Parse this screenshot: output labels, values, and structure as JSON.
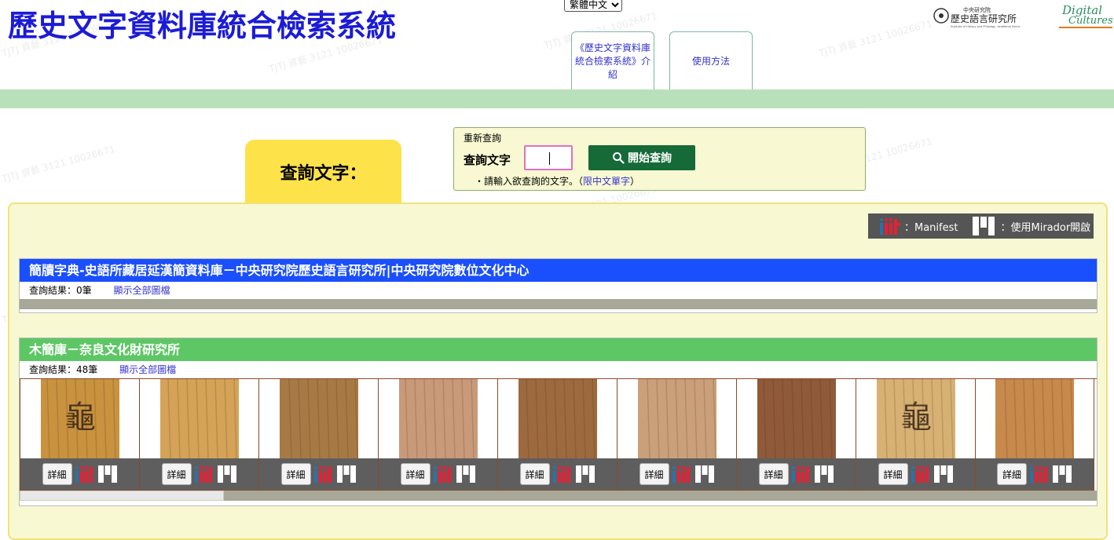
{
  "header": {
    "title": "歷史文字資料庫統合檢索系統",
    "language_selected": "繁體中文",
    "tabs": [
      {
        "label": "《歷史文字資料庫統合檢索系統》介紹"
      },
      {
        "label": "使用方法"
      }
    ],
    "logo_ihp": {
      "main": "歷史語言研究所",
      "top": "中央研究院",
      "sub": "Institute of History and Philology, Academia Sinica"
    },
    "logo_dc": {
      "line1": "Digital",
      "line2": "Cultures",
      "colors": [
        "#2a8f5c",
        "#e07a1e"
      ]
    }
  },
  "query": {
    "tab_label": "查詢文字：",
    "legend": "重新查詢",
    "label": "查詢文字",
    "input_value": "",
    "search_button": "開始查詢",
    "hint": "・請輸入欲查詢的文字。（",
    "hint_link": "限中文單字",
    "hint_end": "）"
  },
  "iiif_legend": {
    "manifest_label": "：Manifest",
    "mirador_label": "：使用Mirador開啟"
  },
  "databases": [
    {
      "title": "簡牘字典-史語所藏居延漢簡資料庫－中央研究院歷史語言研究所|中央研究院數位文化中心",
      "result_label": "查詢結果：0筆",
      "show_all": "顯示全部圖檔",
      "header_color": "#1a4ffd"
    },
    {
      "title": "木簡庫－奈良文化財研究所",
      "result_label": "查詢結果：48筆",
      "show_all": "顯示全部圖檔",
      "header_color": "#5ec765",
      "scroll_position": 0.19
    }
  ],
  "results": [
    {
      "detail": "詳細",
      "glyph": "龜",
      "tone": "#c8923f"
    },
    {
      "detail": "詳細",
      "glyph": "",
      "tone": "#d4a357"
    },
    {
      "detail": "詳細",
      "glyph": "",
      "tone": "#a77a45"
    },
    {
      "detail": "詳細",
      "glyph": "",
      "tone": "#c89a7a"
    },
    {
      "detail": "詳細",
      "glyph": "",
      "tone": "#9c6a3e"
    },
    {
      "detail": "詳細",
      "glyph": "",
      "tone": "#caa07a"
    },
    {
      "detail": "詳細",
      "glyph": "",
      "tone": "#8e5a3a"
    },
    {
      "detail": "詳細",
      "glyph": "龜",
      "tone": "#d7b073"
    },
    {
      "detail": "詳細",
      "glyph": "",
      "tone": "#c7894c"
    }
  ]
}
